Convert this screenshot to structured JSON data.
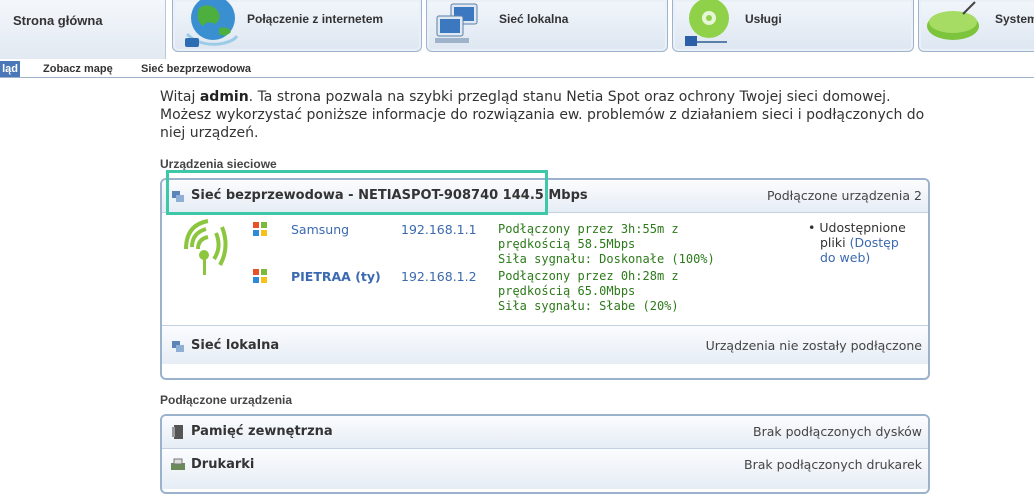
{
  "nav": {
    "home": "Strona główna",
    "tabs": [
      {
        "label": "Połączenie z internetem",
        "icon": "globe-icon"
      },
      {
        "label": "Sieć lokalna",
        "icon": "computers-icon"
      },
      {
        "label": "Usługi",
        "icon": "services-disc-icon"
      },
      {
        "label": "System",
        "icon": "router-icon"
      }
    ]
  },
  "subnav": {
    "active": "ląd",
    "items": [
      "Zobacz mapę",
      "Sieć bezprzewodowa"
    ]
  },
  "intro": {
    "prefix": "Witaj ",
    "user": "admin",
    "text": ". Ta strona pozwala na szybki przegląd stanu Netia Spot oraz ochrony Twojej sieci domowej. Możesz wykorzystać poniższe informacje do rozwiązania ew. problemów z działaniem sieci i podłączonych do niej urządzeń."
  },
  "network_section": {
    "title": "Urządzenia sieciowe",
    "wifi": {
      "title": "Sieć bezprzewodowa - NETIASPOT-908740 144.5 Mbps",
      "right": "Podłączone urządzenia 2",
      "devices": [
        {
          "name": "Samsung",
          "ip": "192.168.1.1",
          "status1": "Podłączony przez 3h:55m z",
          "status2": "prędkością 58.5Mbps",
          "status3": "Siła sygnału: Doskonałe (100%)"
        },
        {
          "name": "PIETRAA (ty)",
          "ip": "192.168.1.2",
          "status1": "Podłączony przez 0h:28m z",
          "status2": "prędkością 65.0Mbps",
          "status3": "Siła sygnału: Słabe (20%)"
        }
      ],
      "shared_label_1": "Udostępnione",
      "shared_label_2": "pliki ",
      "shared_link": "(Dostęp do web)"
    },
    "lan": {
      "title": "Sieć lokalna",
      "right": "Urządzenia nie zostały podłączone"
    }
  },
  "connected_section": {
    "title": "Podłączone urządzenia",
    "storage": {
      "title": "Pamięć zewnętrzna",
      "right": "Brak podłączonych dysków"
    },
    "printers": {
      "title": "Drukarki",
      "right": "Brak podłączonych drukarek"
    }
  },
  "colors": {
    "accent": "#4a77b8",
    "highlight": "#3fc8a8",
    "status_green": "#2c7a1a",
    "link": "#3b6ab0"
  }
}
